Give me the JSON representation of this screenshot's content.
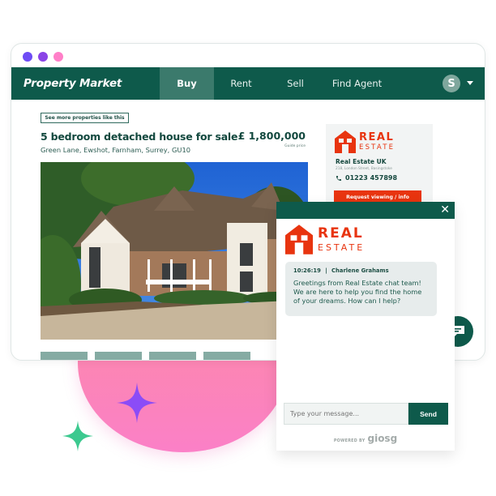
{
  "window": {
    "dots": [
      "#6e4cf5",
      "#8a44e6",
      "#ff7fc8"
    ]
  },
  "navbar": {
    "brand": "Property Market",
    "items": [
      {
        "label": "Buy",
        "active": true
      },
      {
        "label": "Rent",
        "active": false
      },
      {
        "label": "Sell",
        "active": false
      },
      {
        "label": "Find Agent",
        "active": false
      }
    ],
    "avatar_initial": "S"
  },
  "listing": {
    "see_more_label": "See more properties like this",
    "title": "5 bedroom detached house for sale",
    "address": "Green Lane, Ewshot, Farnham, Surrey, GU10",
    "price": "£ 1,800,000",
    "price_note": "Guide price",
    "photo_icon": "house-photo",
    "thumbnail_count": 4
  },
  "agent": {
    "logo_line1": "REAL",
    "logo_line2": "ESTATE",
    "name": "Real Estate UK",
    "address": "218, London Street, Basingstoke",
    "phone": "01223 457898",
    "request_label": "Request viewing / info"
  },
  "chat": {
    "close_label": "✕",
    "logo_line1": "REAL",
    "logo_line2": "ESTATE",
    "message": {
      "time": "10:26:19",
      "separator": "|",
      "sender": "Charlene Grahams",
      "text": "Greetings from Real Estate chat team! We are here to help you find the home of your dreams. How can I help?"
    },
    "input_placeholder": "Type your message...",
    "send_label": "Send",
    "powered_by": "POWERED BY",
    "powered_brand": "giosg"
  },
  "colors": {
    "brand_green": "#0e5a4b",
    "accent_red": "#e8340f",
    "pink": "#fb80c7",
    "sparkle_purple": "#8b4cf7",
    "sparkle_green": "#3cc98f"
  }
}
